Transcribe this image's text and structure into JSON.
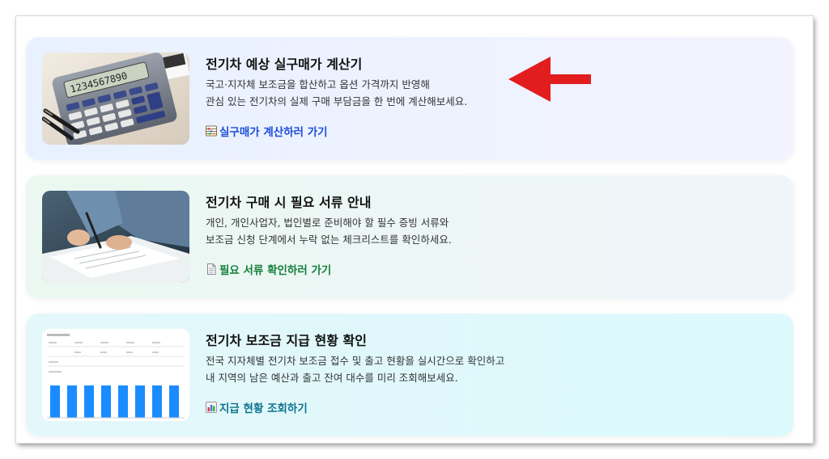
{
  "cards": [
    {
      "title": "전기차 예상 실구매가 계산기",
      "desc": [
        "국고·지자체 보조금을 합산하고 옵션 가격까지 반영해",
        "관심 있는 전기차의 실제 구매 부담금을 한 번에 계산해보세요."
      ],
      "link_label": "실구매가 계산하러 가기",
      "link_color": "#1d4fd8",
      "link_icon": "abacus-icon",
      "image": "calculator-photo",
      "calculator_display": "1234567890"
    },
    {
      "title": "전기차 구매 시 필요 서류 안내",
      "desc": [
        "개인, 개인사업자, 법인별로 준비해야 할 필수 증빙 서류와",
        "보조금 신청 단계에서 누락 없는 체크리스트를 확인하세요."
      ],
      "link_label": "필요 서류 확인하러 가기",
      "link_color": "#15803d",
      "link_icon": "document-icon",
      "image": "signing-document-photo"
    },
    {
      "title": "전기차 보조금 지급 현황 확인",
      "desc": [
        "전국 지자체별 전기차 보조금 접수 및 출고 현황을 실시간으로 확인하고",
        "내 지역의 남은 예산과 출고 잔여 대수를 미리 조회해보세요."
      ],
      "link_label": "지급 현황 조회하기",
      "link_color": "#0e7490",
      "link_icon": "bar-chart-icon",
      "image": "subsidy-status-chart-screenshot"
    }
  ],
  "annotation": {
    "arrow_color": "#e11d1d",
    "arrow_direction": "left"
  }
}
